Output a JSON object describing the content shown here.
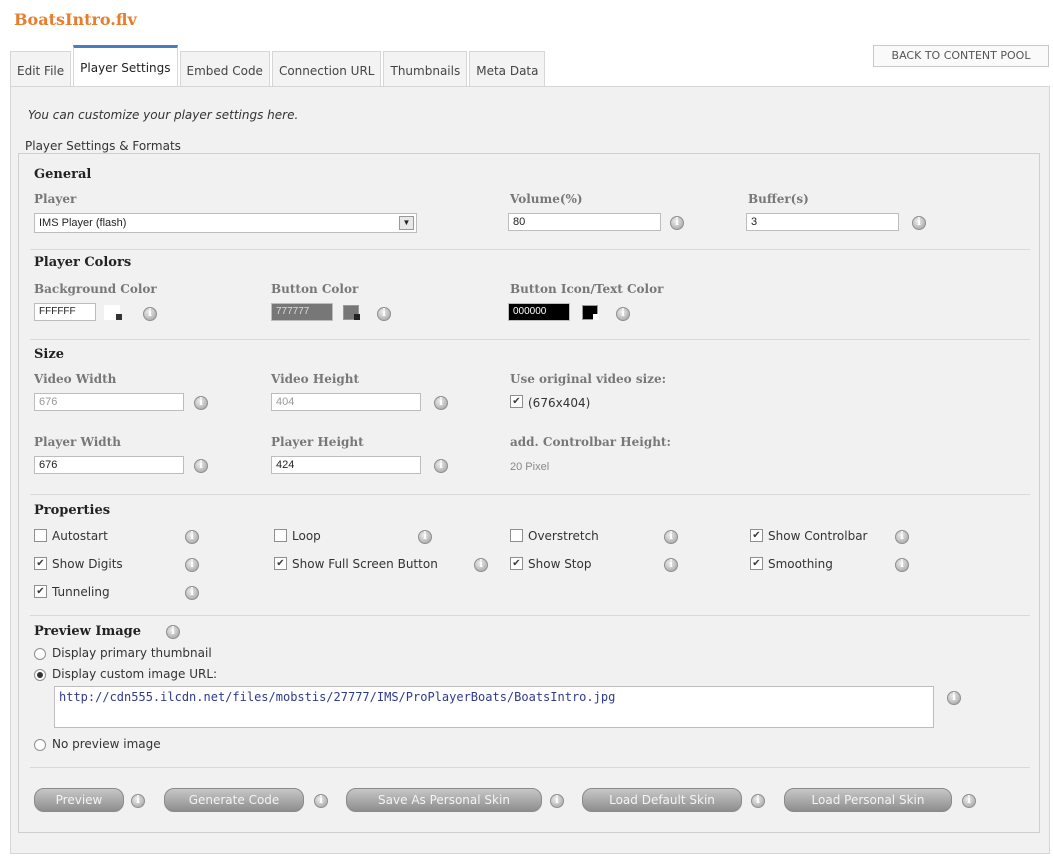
{
  "page_title": "BoatsIntro.flv",
  "back_button": "BACK TO CONTENT POOL",
  "tabs": [
    {
      "label": "Edit File"
    },
    {
      "label": "Player Settings"
    },
    {
      "label": "Embed Code"
    },
    {
      "label": "Connection URL"
    },
    {
      "label": "Thumbnails"
    },
    {
      "label": "Meta Data"
    }
  ],
  "active_tab": "Player Settings",
  "intro": "You can customize your player settings here.",
  "fieldset_legend": "Player Settings & Formats",
  "general": {
    "title": "General",
    "player_label": "Player",
    "player_value": "IMS Player (flash)",
    "volume_label": "Volume(%)",
    "volume_value": "80",
    "buffer_label": "Buffer(s)",
    "buffer_value": "3"
  },
  "colors": {
    "title": "Player Colors",
    "background_label": "Background Color",
    "background_value": "FFFFFF",
    "button_label": "Button Color",
    "button_value": "777777",
    "icon_label": "Button Icon/Text Color",
    "icon_value": "000000",
    "background_hex": "#FFFFFF",
    "button_hex": "#777777",
    "icon_hex": "#000000"
  },
  "size": {
    "title": "Size",
    "video_width_label": "Video Width",
    "video_width_value": "676",
    "video_height_label": "Video Height",
    "video_height_value": "404",
    "original_label": "Use original video size:",
    "original_checked": true,
    "original_value": "(676x404)",
    "player_width_label": "Player Width",
    "player_width_value": "676",
    "player_height_label": "Player Height",
    "player_height_value": "424",
    "controlbar_label": "add. Controlbar Height:",
    "controlbar_value": "20 Pixel"
  },
  "properties": {
    "title": "Properties",
    "items": [
      {
        "label": "Autostart",
        "checked": false
      },
      {
        "label": "Loop",
        "checked": false
      },
      {
        "label": "Overstretch",
        "checked": false
      },
      {
        "label": "Show Controlbar",
        "checked": true
      },
      {
        "label": "Show Digits",
        "checked": true
      },
      {
        "label": "Show Full Screen Button",
        "checked": true
      },
      {
        "label": "Show Stop",
        "checked": true
      },
      {
        "label": "Smoothing",
        "checked": true
      },
      {
        "label": "Tunneling",
        "checked": true
      }
    ]
  },
  "preview": {
    "title": "Preview Image",
    "option_primary": "Display primary thumbnail",
    "option_custom": "Display custom image URL:",
    "option_none": "No preview image",
    "selected": "custom",
    "url": "http://cdn555.ilcdn.net/files/mobstis/27777/IMS/ProPlayerBoats/BoatsIntro.jpg"
  },
  "buttons": {
    "preview": "Preview",
    "generate": "Generate Code",
    "save_skin": "Save As Personal Skin",
    "load_default": "Load Default Skin",
    "load_personal": "Load Personal Skin"
  },
  "icons": {
    "info": "info-icon",
    "check": "checkmark-icon",
    "dropdown": "dropdown-arrow-icon",
    "color_picker": "color-picker-icon"
  },
  "accent_colors": {
    "title": "#E87D2C",
    "active_tab": "#4A7CC2",
    "url_text": "#2F3A8C"
  }
}
